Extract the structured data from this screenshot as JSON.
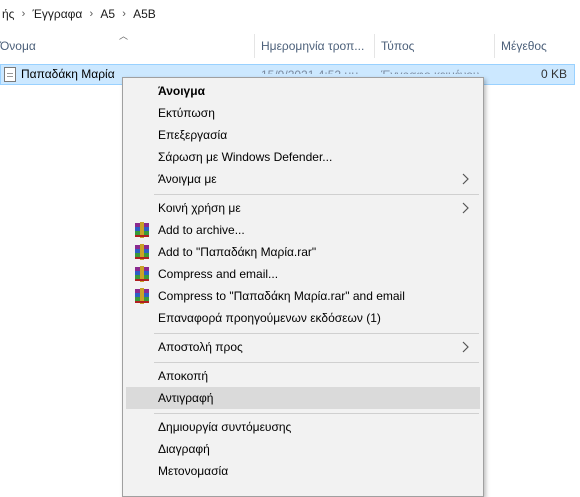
{
  "breadcrumb": [
    "ής",
    "Έγγραφα",
    "A5",
    "A5B"
  ],
  "columns": {
    "name": "Όνομα",
    "date": "Ημερομηνία τροπ...",
    "type": "Τύπος",
    "size": "Μέγεθος"
  },
  "file": {
    "name": "Παπαδάκη Μαρία",
    "date": "15/9/2021 4:52 μμ",
    "type": "Έγγραφο κειμένου",
    "size": "0 KB"
  },
  "menu": {
    "open": "Άνοιγμα",
    "print": "Εκτύπωση",
    "edit": "Επεξεργασία",
    "scan": "Σάρωση με Windows Defender...",
    "open_with": "Άνοιγμα με",
    "share_with": "Κοινή χρήση με",
    "add_archive": "Add to archive...",
    "add_rar": "Add to \"Παπαδάκη Μαρία.rar\"",
    "compress_email": "Compress and email...",
    "compress_rar_email": "Compress to \"Παπαδάκη Μαρία.rar\" and email",
    "restore_versions": "Επαναφορά προηγούμενων εκδόσεων (1)",
    "send_to": "Αποστολή προς",
    "cut": "Αποκοπή",
    "copy": "Αντιγραφή",
    "create_shortcut": "Δημιουργία συντόμευσης",
    "delete": "Διαγραφή",
    "rename": "Μετονομασία"
  },
  "icons": {
    "archive": "winrar-icon",
    "submenu": "chevron-right-icon",
    "file": "text-file-icon"
  },
  "colors": {
    "selection": "#cce8ff",
    "menu_bg": "#f2f2f2",
    "menu_hover": "#dadada"
  }
}
